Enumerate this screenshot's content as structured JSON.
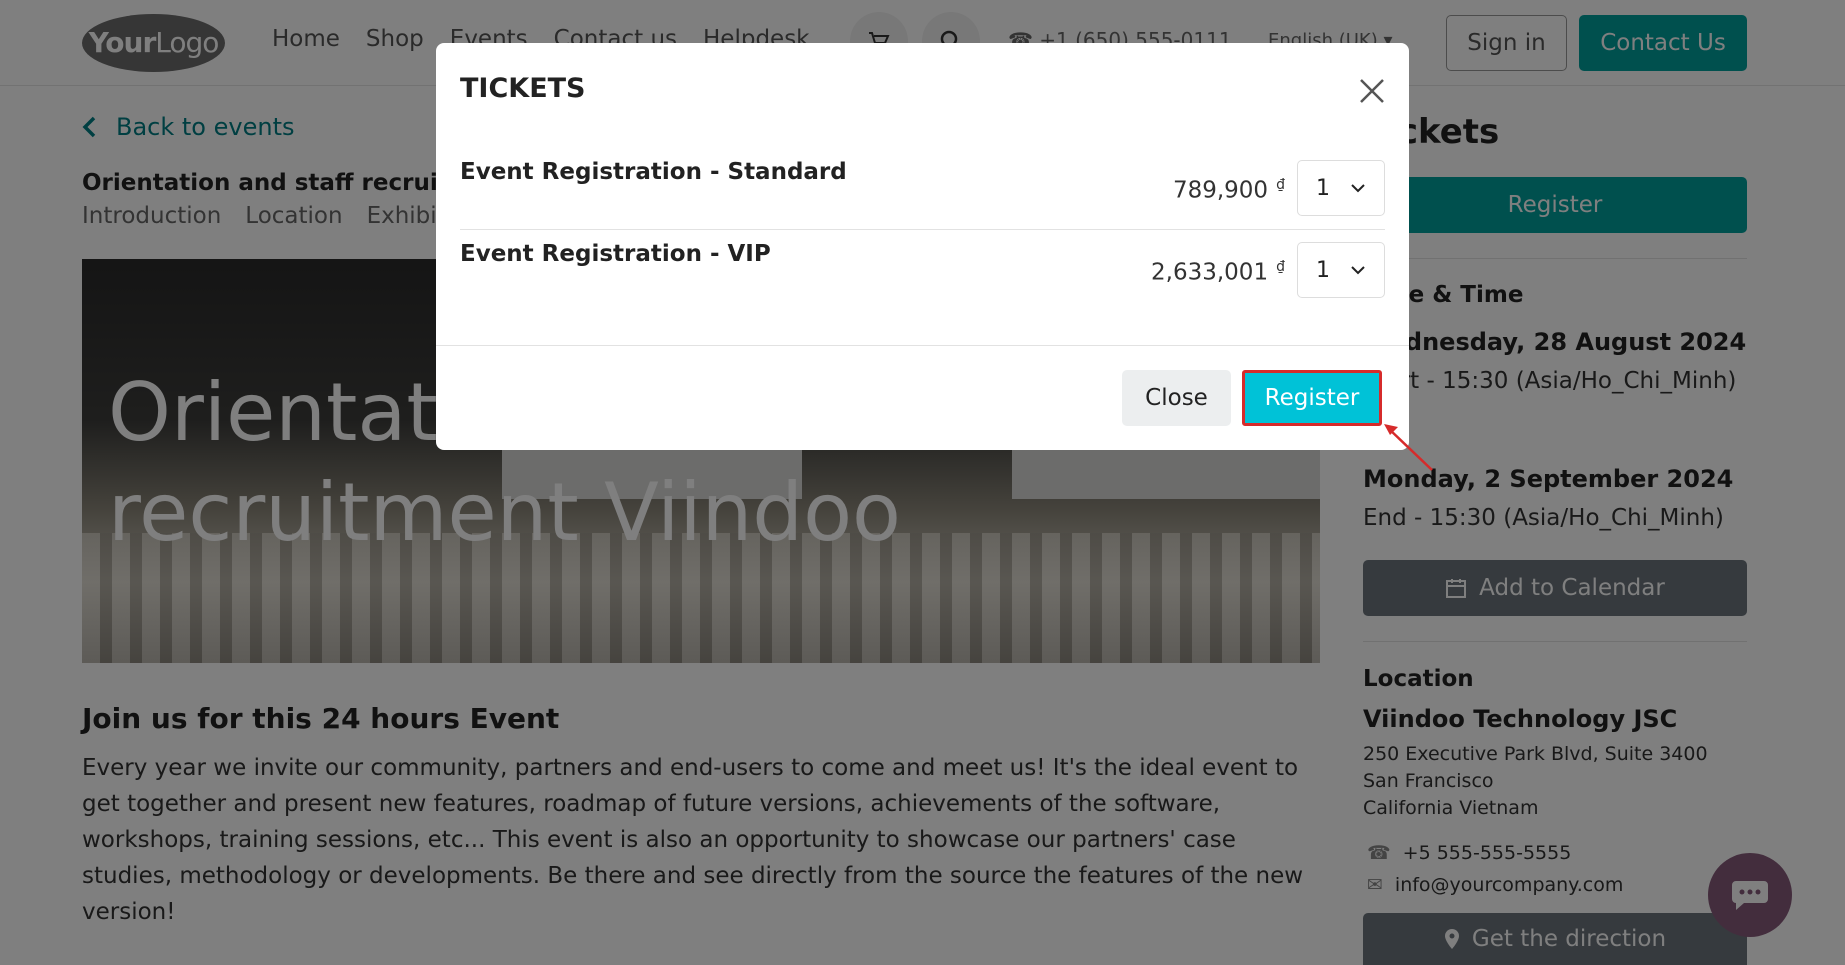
{
  "header": {
    "logo_bold": "Your",
    "logo_thin": "Logo",
    "nav": [
      "Home",
      "Shop",
      "Events",
      "Contact us",
      "Helpdesk"
    ],
    "phone": "+1 (650) 555-0111",
    "language": "English (UK)",
    "sign_in": "Sign in",
    "contact_us": "Contact Us"
  },
  "page": {
    "back_link": "Back to events",
    "event_title": "Orientation and staff recruitment Viindoo",
    "subnav": [
      "Introduction",
      "Location",
      "Exhibitors"
    ],
    "hero_title_line1": "Orientation and staff",
    "hero_title_line2": "recruitment Viindoo",
    "section_heading": "Join us for this 24 hours Event",
    "description": "Every year we invite our community, partners and end-users to come and meet us! It's the ideal event to get together and present new features, roadmap of future versions, achievements of the software, workshops, training sessions, etc... This event is also an opportunity to showcase our partners' case studies, methodology or developments. Be there and see directly from the source the features of the new version!"
  },
  "sidebar": {
    "heading": "Tickets",
    "register": "Register",
    "date_time_label": "Date & Time",
    "start_date": "Wednesday, 28 August 2024",
    "start_time": "Start - 15:30 (Asia/Ho_Chi_Minh)",
    "end_date": "Monday, 2 September 2024",
    "end_time": "End - 15:30 (Asia/Ho_Chi_Minh)",
    "add_to_calendar": "Add to Calendar",
    "location_label": "Location",
    "company": "Viindoo Technology JSC",
    "address_1": "250 Executive Park Blvd, Suite 3400",
    "address_2": "San Francisco",
    "address_3": "California Vietnam",
    "phone": "+5 555-555-5555",
    "email": "info@yourcompany.com",
    "directions": "Get the direction"
  },
  "modal": {
    "title": "TICKETS",
    "tickets": [
      {
        "name": "Event Registration - Standard",
        "price": "789,900",
        "currency": "₫",
        "quantity": "1"
      },
      {
        "name": "Event Registration - VIP",
        "price": "2,633,001",
        "currency": "₫",
        "quantity": "1"
      }
    ],
    "close_label": "Close",
    "register_label": "Register"
  },
  "colors": {
    "primary": "#00a09d",
    "register_highlight": "#00c2d7",
    "annotation_red": "#d62b2b",
    "chat": "#875a7b"
  }
}
